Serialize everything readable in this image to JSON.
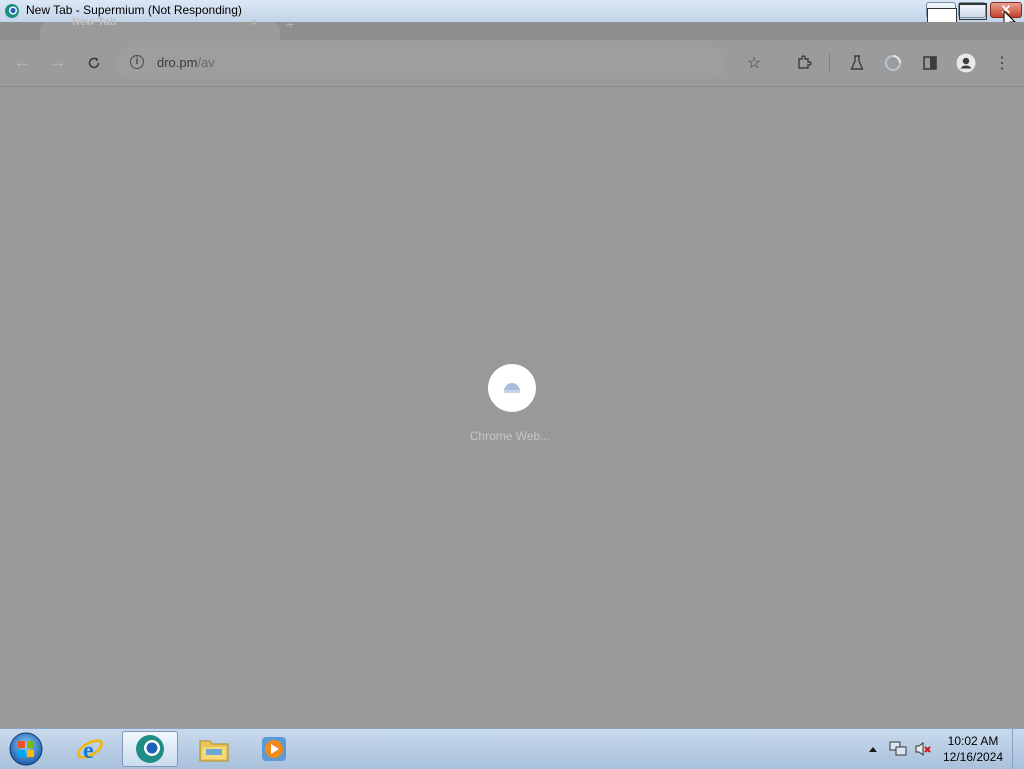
{
  "window": {
    "title": "New Tab - Supermium (Not Responding)",
    "close_color": "#c4402c"
  },
  "tabs": [
    {
      "label": "New Tab"
    }
  ],
  "toolbar": {
    "url_host": "dro.pm",
    "url_path": "/av"
  },
  "content": {
    "loading_label": "Chrome Web...",
    "background_color": "#999999"
  },
  "taskbar": {
    "apps": [
      {
        "name": "internet-explorer"
      },
      {
        "name": "supermium",
        "active": true
      },
      {
        "name": "file-explorer"
      },
      {
        "name": "media-player"
      }
    ],
    "clock_time": "10:02 AM",
    "clock_date": "12/16/2024"
  }
}
